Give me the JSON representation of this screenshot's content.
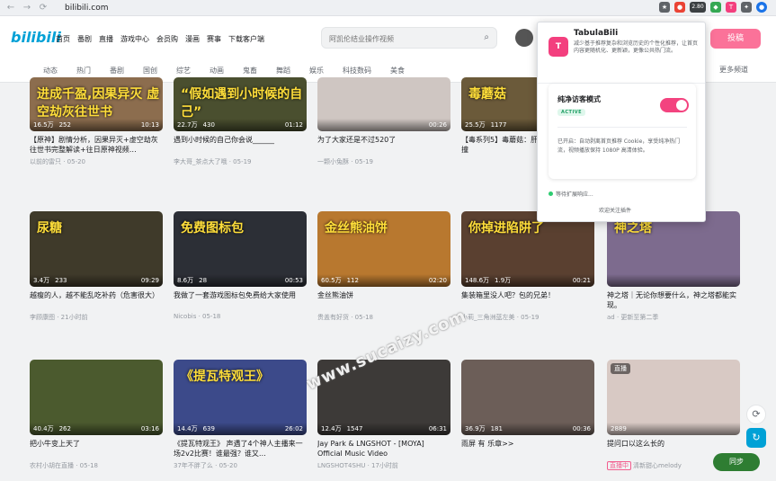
{
  "browser": {
    "url": "bilibili.com",
    "ext_badge": "2.80"
  },
  "header": {
    "logo": "bilibili",
    "nav": [
      "首页",
      "番剧",
      "直播",
      "游戏中心",
      "会员购",
      "漫画",
      "赛事",
      "下载客户端"
    ],
    "search_placeholder": "阿凯伦结业操作视频",
    "post_label": "投稿"
  },
  "channels": {
    "items": [
      "动态",
      "热门",
      "番剧",
      "国创",
      "综艺",
      "动画",
      "鬼畜",
      "舞蹈",
      "娱乐",
      "科技数码",
      "美食"
    ],
    "more": "更多频道"
  },
  "feed": {
    "row1": [
      {
        "caption": "进成千盈,因果异灭\n虚空劫灰往世书",
        "views": "16.5万",
        "likes": "252",
        "duration": "10:13",
        "title": "【原神】剧情分析，因果异灭+虚空劫灰往世书完整解读+往日原神视频…",
        "author": "以前的雷只 · 05-20",
        "color": "#8c6d4e"
      },
      {
        "caption": "“假如遇到小时候的自己”",
        "views": "22.7万",
        "likes": "430",
        "duration": "01:12",
        "title": "遇到小时候的自己你会说______",
        "author": "李大哥_茶点大了哦 · 05-19",
        "color": "#4a4f2f"
      },
      {
        "caption": "",
        "views": "",
        "likes": "",
        "duration": "00:26",
        "title": "为了大家还是不过520了",
        "author": "一颗小兔酥 · 05-19",
        "color": "#cfc6c2"
      },
      {
        "caption": "毒蘑菇",
        "views": "25.5万",
        "likes": "1177",
        "duration": "",
        "title": "【毒系列5】毒蘑菇：肝胃衰竭，蝶衍幻撞",
        "author": "",
        "color": "#6b5a3a"
      }
    ],
    "row2": [
      {
        "caption": "尿糖",
        "views": "3.4万",
        "likes": "233",
        "duration": "09:29",
        "title": "越瘦的人，越不能乱吃补药（危害很大）",
        "author": "李顾康图 · 21小时前",
        "color": "#3f3a2a"
      },
      {
        "caption": "免费图标包",
        "views": "8.6万",
        "likes": "28",
        "duration": "00:53",
        "title": "我做了一套游戏图标包免费给大家使用",
        "author": "Nicobis · 05-18",
        "color": "#2c2f36"
      },
      {
        "caption": "金丝熊油饼",
        "views": "60.5万",
        "likes": "112",
        "duration": "02:20",
        "title": "金丝熊油饼",
        "author": "贵盖有好货 · 05-18",
        "color": "#b8782f"
      },
      {
        "caption": "你掉进陷阱了",
        "views": "148.6万",
        "likes": "1.9万",
        "duration": "00:21",
        "title": "集装箱里没人吧？包的兄弟！",
        "author": "小莉_三角洲蓝左美 · 05-19",
        "color": "#5a4030"
      },
      {
        "caption": "神之塔",
        "views": "",
        "likes": "",
        "duration": "",
        "title": "神之塔｜无论你想要什么，神之塔都能实现。",
        "author": "ad · 更新至第二季",
        "color": "#7d6b8e"
      }
    ],
    "row3": [
      {
        "caption": "",
        "views": "40.4万",
        "likes": "262",
        "duration": "03:16",
        "title": "把小牛变上天了",
        "author": "农村小胡在直播 · 05-18",
        "color": "#4b5a2e"
      },
      {
        "caption": "《提瓦特观王》",
        "views": "14.4万",
        "likes": "639",
        "duration": "26:02",
        "title": "《提瓦特观王》 声遇了4个神人主播来一场2v2比赛！谁最强？谁又…",
        "author": "37年不胖了么 · 05-20",
        "color": "#3c4a8a"
      },
      {
        "caption": "",
        "views": "12.4万",
        "likes": "1547",
        "duration": "06:31",
        "title": "Jay Park & LNGSHOT - [MOYA] Official Music Video",
        "author": "LNGSHOT4SHU · 17小时前",
        "color": "#3d3a38"
      },
      {
        "caption": "",
        "views": "36.9万",
        "likes": "181",
        "duration": "00:36",
        "title": "雨屏 有 乐章>>",
        "author": "",
        "color": "#6c5e58"
      },
      {
        "caption": "",
        "views": "2889",
        "likes": "",
        "duration": "",
        "title": "提问口以这么长的",
        "author": "清新甜心melody",
        "color": "#d8c9c4",
        "live": "直播",
        "badge": "直播中"
      }
    ]
  },
  "watermark": "www.sucaizy.com",
  "sync_label": "同步",
  "popup": {
    "logo_letter": "T",
    "title": "TabulaBili",
    "desc": "减少基于推荐复杂和浏览历史的个性化推荐，让首页内容更随机化、更新颖，更像公共热门流。",
    "mode_title": "纯净访客模式",
    "active_label": "ACTIVE",
    "toggle_on": true,
    "status_text": "已开启：自动剥离首页推荐 Cookie，享受纯净热门流，视频播放保持 1080P 高清体验。",
    "loading_text": "等待扩展响应...",
    "footer": "欢迎关注插件",
    "accent": "#f3437f"
  }
}
